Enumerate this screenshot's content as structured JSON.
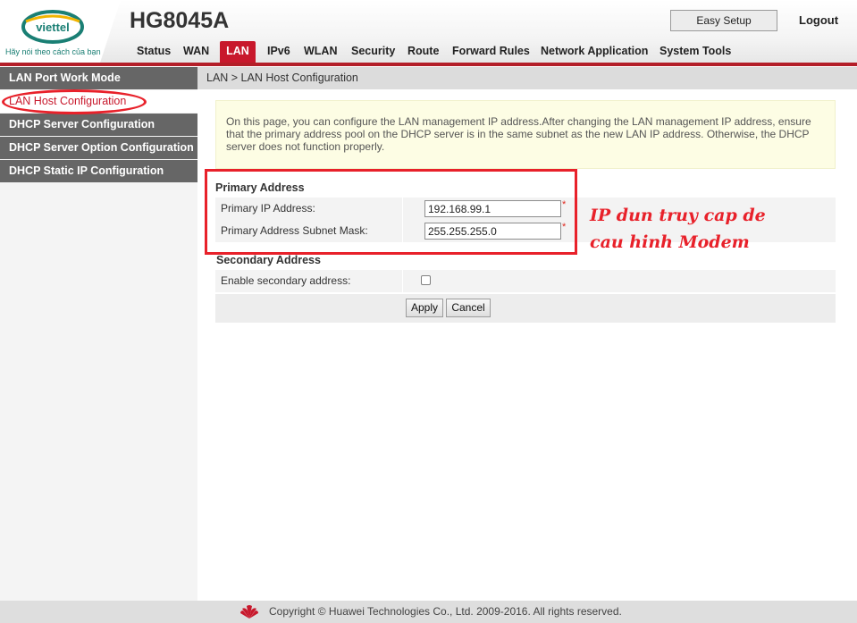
{
  "header": {
    "logo_text": "viettel",
    "slogan": "Hãy nói theo cách của bạn",
    "product_name": "HG8045A",
    "easy_setup_label": "Easy Setup",
    "logout_label": "Logout"
  },
  "nav": {
    "tabs": [
      {
        "label": "Status",
        "active": false
      },
      {
        "label": "WAN",
        "active": false
      },
      {
        "label": "LAN",
        "active": true
      },
      {
        "label": "IPv6",
        "active": false
      },
      {
        "label": "WLAN",
        "active": false
      },
      {
        "label": "Security",
        "active": false
      },
      {
        "label": "Route",
        "active": false
      },
      {
        "label": "Forward Rules",
        "active": false
      },
      {
        "label": "Network Application",
        "active": false
      },
      {
        "label": "System Tools",
        "active": false
      }
    ]
  },
  "sidebar": {
    "items": [
      {
        "label": "LAN Port Work Mode",
        "active": false
      },
      {
        "label": "LAN Host Configuration",
        "active": true
      },
      {
        "label": "DHCP Server Configuration",
        "active": false
      },
      {
        "label": "DHCP Server Option Configuration",
        "active": false
      },
      {
        "label": "DHCP Static IP Configuration",
        "active": false
      }
    ]
  },
  "breadcrumb": "LAN > LAN Host Configuration",
  "info_text": "On this page, you can configure the LAN management IP address.After changing the LAN management IP address, ensure that the primary address pool on the DHCP server is in the same subnet as the new LAN IP address. Otherwise, the DHCP server does not function properly.",
  "primary": {
    "title": "Primary Address",
    "ip_label": "Primary IP Address:",
    "ip_value": "192.168.99.1",
    "mask_label": "Primary Address Subnet Mask:",
    "mask_value": "255.255.255.0",
    "required_mark": "*"
  },
  "secondary": {
    "title": "Secondary Address",
    "enable_label": "Enable secondary address:",
    "enabled": false
  },
  "buttons": {
    "apply": "Apply",
    "cancel": "Cancel"
  },
  "annotation": {
    "line1": "IP dun truy cap de",
    "line2": "cau hinh Modem",
    "color": "#e8212a"
  },
  "footer": {
    "copyright": "Copyright © Huawei Technologies Co., Ltd. 2009-2016. All rights reserved."
  },
  "colors": {
    "brand_red": "#c8182c",
    "sidebar_gray": "#666666",
    "viettel_green": "#1a7f74"
  }
}
